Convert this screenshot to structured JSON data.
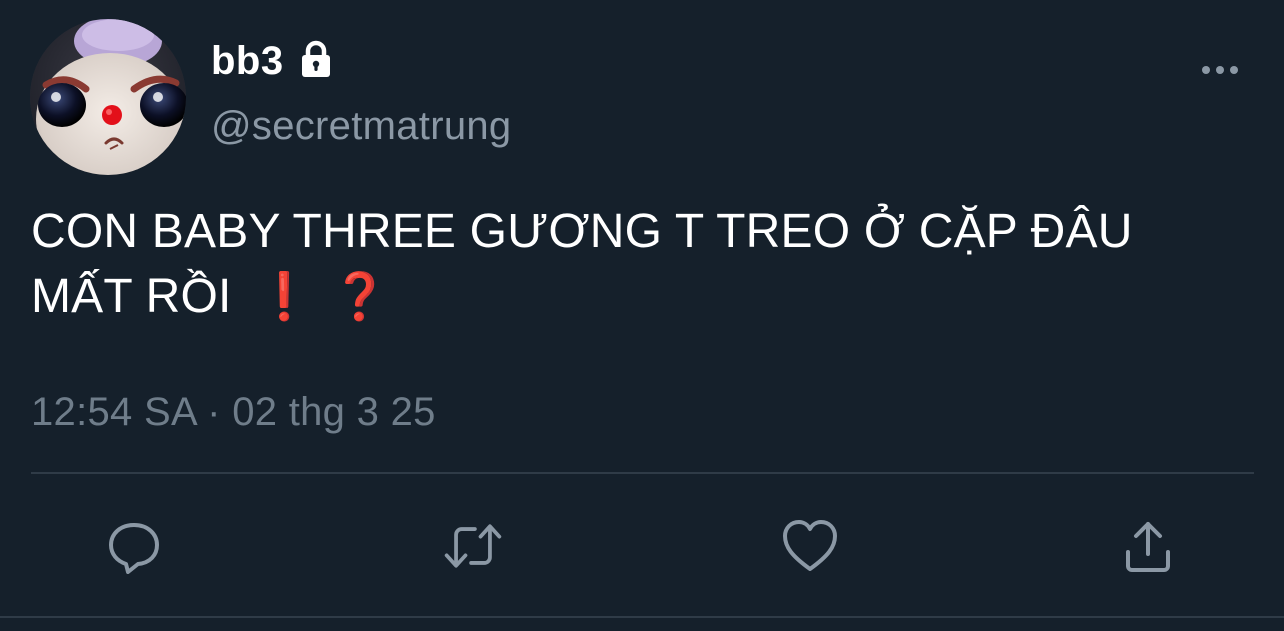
{
  "user": {
    "display_name": "bb3",
    "handle": "@secretmatrung",
    "protected_icon": "lock-icon",
    "avatar_icon": "avatar-image"
  },
  "tweet": {
    "text_line1": "CON BABY THREE GƯƠNG T TREO Ở CẶP ĐÂU",
    "text_line2": "MẤT RỒI",
    "emoji_exclamation": "❗",
    "emoji_question": "❓",
    "timestamp": "12:54 SA · 02 thg 3 25"
  },
  "actions": {
    "more": "more-horizontal-icon",
    "reply": "reply-icon",
    "retweet": "retweet-icon",
    "like": "heart-icon",
    "share": "share-icon"
  },
  "colors": {
    "background": "#15202b",
    "secondary_text": "#8b98a5",
    "timestamp_text": "#6f7d8a",
    "divider": "#2f3b47",
    "emoji_red": "#e0201b"
  }
}
